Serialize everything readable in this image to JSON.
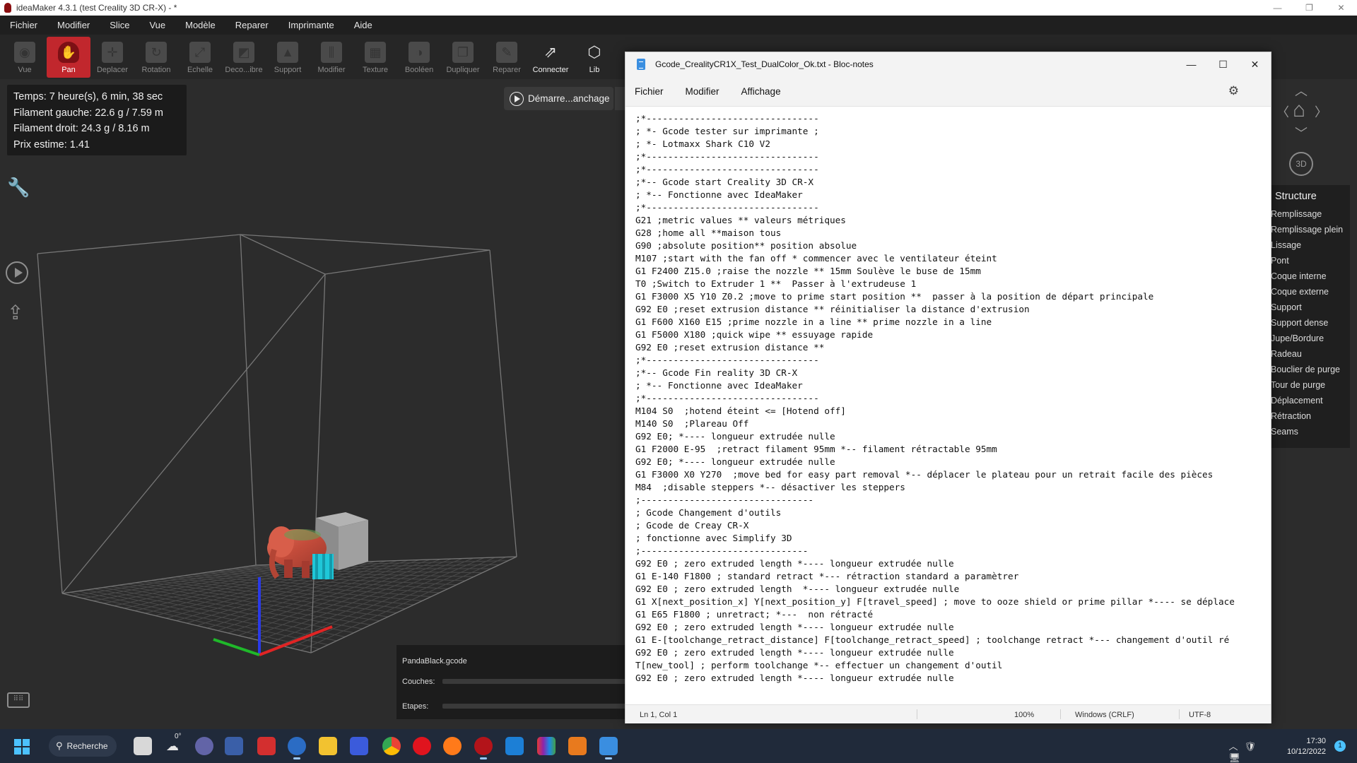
{
  "ideamaker": {
    "title": "ideaMaker 4.3.1 (test Creality 3D CR-X) - *",
    "window_controls": [
      "—",
      "❐",
      "✕"
    ],
    "menu": [
      "Fichier",
      "Modifier",
      "Slice",
      "Vue",
      "Modèle",
      "Reparer",
      "Imprimante",
      "Aide"
    ],
    "toolbar": [
      {
        "label": "Vue",
        "icon": "eye-icon",
        "glyph": "◉"
      },
      {
        "label": "Pan",
        "icon": "hand-icon",
        "glyph": "✋",
        "active": true
      },
      {
        "label": "Deplacer",
        "icon": "move-icon",
        "glyph": "✛"
      },
      {
        "label": "Rotation",
        "icon": "rotate-icon",
        "glyph": "↻"
      },
      {
        "label": "Echelle",
        "icon": "scale-icon",
        "glyph": "⤢"
      },
      {
        "label": "Deco...ibre",
        "icon": "cut-icon",
        "glyph": "◩"
      },
      {
        "label": "Support",
        "icon": "support-icon",
        "glyph": "▲"
      },
      {
        "label": "Modifier",
        "icon": "sliders-icon",
        "glyph": "⫼"
      },
      {
        "label": "Texture",
        "icon": "texture-icon",
        "glyph": "▦"
      },
      {
        "label": "Booléen",
        "icon": "boolean-icon",
        "glyph": "◑"
      },
      {
        "label": "Dupliquer",
        "icon": "duplicate-icon",
        "glyph": "❐"
      },
      {
        "label": "Reparer",
        "icon": "wrench-icon",
        "glyph": "✎"
      },
      {
        "label": "Connecter",
        "icon": "connect-icon",
        "glyph": "⇗",
        "bright": true
      },
      {
        "label": "Lib",
        "icon": "library-icon",
        "glyph": "⬡",
        "bright": true
      }
    ],
    "stats": [
      "Temps: 7 heure(s), 6 min, 38 sec",
      "Filament gauche: 22.6 g / 7.59 m",
      "Filament droit: 24.3 g / 8.16 m",
      "Prix estime: 1.41"
    ],
    "slice_button": "Démarre...anchage",
    "layers_panel": {
      "file": "PandaBlack.gcode",
      "layers_label": "Couches:",
      "steps_label": "Etapes:"
    },
    "nav_3d_label": "3D",
    "structure": {
      "title": "Structure",
      "items": [
        "Remplissage",
        "Remplissage plein",
        "Lissage",
        "Pont",
        "Coque interne",
        "Coque externe",
        "Support",
        "Support dense",
        "Jupe/Bordure",
        "Radeau",
        "Bouclier de purge",
        "Tour de purge",
        "Déplacement",
        "Rétraction",
        "Seams"
      ]
    },
    "colors": {
      "accent": "#c1272d",
      "viewport": "#2c2c2c",
      "panel": "#1b1b1b"
    }
  },
  "notepad": {
    "title": "Gcode_CrealityCR1X_Test_DualColor_Ok.txt - Bloc-notes",
    "menu": [
      "Fichier",
      "Modifier",
      "Affichage"
    ],
    "lines": [
      ";*--------------------------------",
      "; *- Gcode tester sur imprimante ;",
      "; *- Lotmaxx Shark C10 V2",
      ";*--------------------------------",
      ";*--------------------------------",
      ";*-- Gcode start Creality 3D CR-X",
      "; *-- Fonctionne avec IdeaMaker",
      ";*--------------------------------",
      "G21 ;metric values ** valeurs métriques",
      "G28 ;home all **maison tous",
      "G90 ;absolute position** position absolue",
      "M107 ;start with the fan off * commencer avec le ventilateur éteint",
      "G1 F2400 Z15.0 ;raise the nozzle ** 15mm Soulève le buse de 15mm",
      "T0 ;Switch to Extruder 1 **  Passer à l'extrudeuse 1",
      "G1 F3000 X5 Y10 Z0.2 ;move to prime start position **  passer à la position de départ principale",
      "G92 E0 ;reset extrusion distance ** réinitialiser la distance d'extrusion",
      "G1 F600 X160 E15 ;prime nozzle in a line ** prime nozzle in a line",
      "G1 F5000 X180 ;quick wipe ** essuyage rapide",
      "G92 E0 ;reset extrusion distance **",
      ";*--------------------------------",
      ";*-- Gcode Fin reality 3D CR-X",
      "; *-- Fonctionne avec IdeaMaker",
      ";*--------------------------------",
      "M104 S0  ;hotend éteint <= [Hotend off]",
      "M140 S0  ;Plareau Off",
      "G92 E0; *---- longueur extrudée nulle",
      "G1 F2000 E-95  ;retract filament 95mm *-- filament rétractable 95mm",
      "G92 E0; *---- longueur extrudée nulle",
      "G1 F3000 X0 Y270  ;move bed for easy part removal *-- déplacer le plateau pour un retrait facile des pièces",
      "M84  ;disable steppers *-- désactiver les steppers",
      ";--------------------------------",
      "; Gcode Changement d'outils",
      "; Gcode de Creay CR-X",
      "; fonctionne avec Simplify 3D",
      ";-------------------------------",
      "G92 E0 ; zero extruded length *---- longueur extrudée nulle",
      "G1 E-140 F1800 ; standard retract *--- rétraction standard a paramètrer",
      "G92 E0 ; zero extruded length  *---- longueur extrudée nulle",
      "G1 X[next_position_x] Y[next_position_y] F[travel_speed] ; move to ooze shield or prime pillar *---- se déplace",
      "G1 E65 F1800 ; unretract; *---  non rétracté",
      "G92 E0 ; zero extruded length *---- longueur extrudée nulle",
      "G1 E-[toolchange_retract_distance] F[toolchange_retract_speed] ; toolchange retract *--- changement d'outil ré",
      "G92 E0 ; zero extruded length *---- longueur extrudée nulle",
      "T[new_tool] ; perform toolchange *-- effectuer un changement d'outil",
      "G92 E0 ; zero extruded length *---- longueur extrudée nulle"
    ],
    "status": {
      "position": "Ln 1, Col 1",
      "zoom": "100%",
      "eol": "Windows (CRLF)",
      "encoding": "UTF-8"
    }
  },
  "taskbar": {
    "search": "Recherche",
    "weather": "0°",
    "time": "17:30",
    "date": "10/12/2022",
    "notifications": "1"
  }
}
